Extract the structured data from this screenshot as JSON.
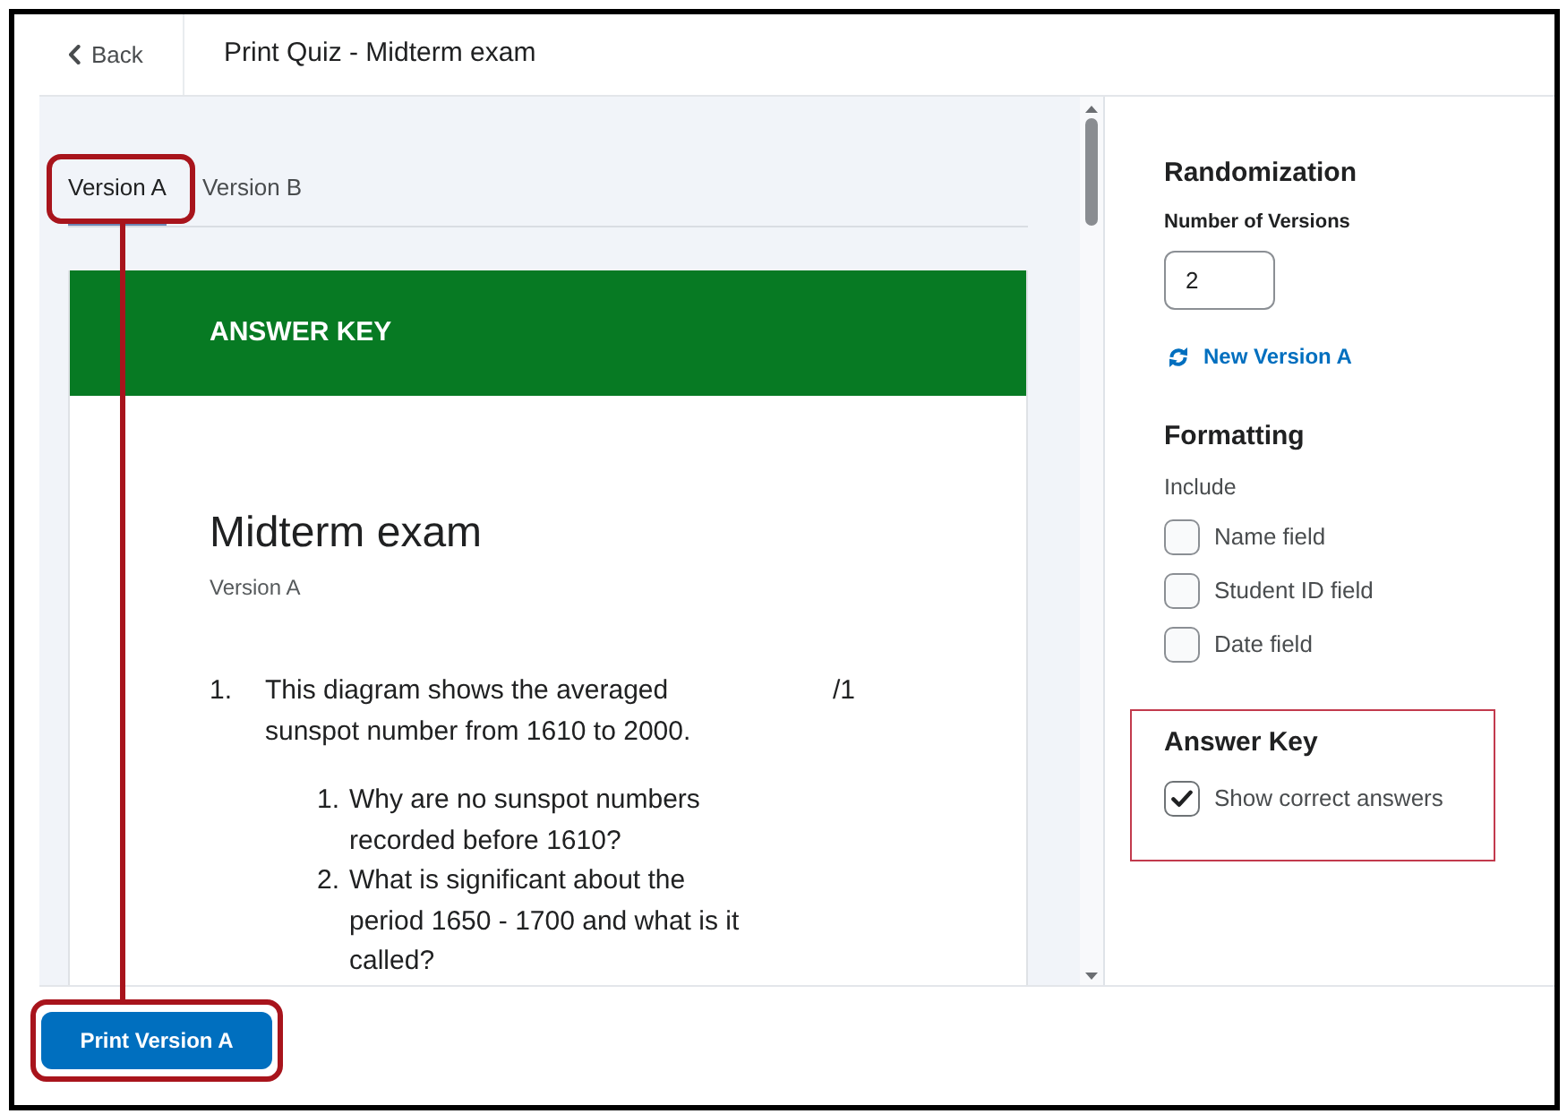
{
  "header": {
    "back_label": "Back",
    "title": "Print Quiz - Midterm exam"
  },
  "tabs": [
    {
      "label": "Version A",
      "selected": true,
      "highlighted": true
    },
    {
      "label": "Version B",
      "selected": false,
      "highlighted": false
    }
  ],
  "preview": {
    "banner": "ANSWER KEY",
    "title": "Midterm exam",
    "version": "Version A",
    "questions": [
      {
        "number": "1.",
        "text": "This diagram shows the averaged sunspot number from 1610 to 2000.",
        "points": "/1",
        "parts": [
          {
            "number": "1.",
            "text": "Why are no sunspot numbers recorded before 1610?"
          },
          {
            "number": "2.",
            "text": "What is significant about the period 1650 - 1700 and what is it called?"
          }
        ]
      }
    ]
  },
  "settings": {
    "randomization": {
      "heading": "Randomization",
      "field_label": "Number of Versions",
      "field_value": "2",
      "link": "New Version A"
    },
    "formatting": {
      "heading": "Formatting",
      "label": "Include",
      "options": [
        {
          "label": "Name field",
          "checked": false
        },
        {
          "label": "Student ID field",
          "checked": false
        },
        {
          "label": "Date field",
          "checked": false
        }
      ]
    },
    "answer_key": {
      "heading": "Answer Key",
      "highlighted": true,
      "options": [
        {
          "label": "Show correct answers",
          "checked": true
        }
      ]
    }
  },
  "footer": {
    "print_button": {
      "label": "Print Version A",
      "highlighted": true
    }
  },
  "annotations": {
    "connector": true
  }
}
